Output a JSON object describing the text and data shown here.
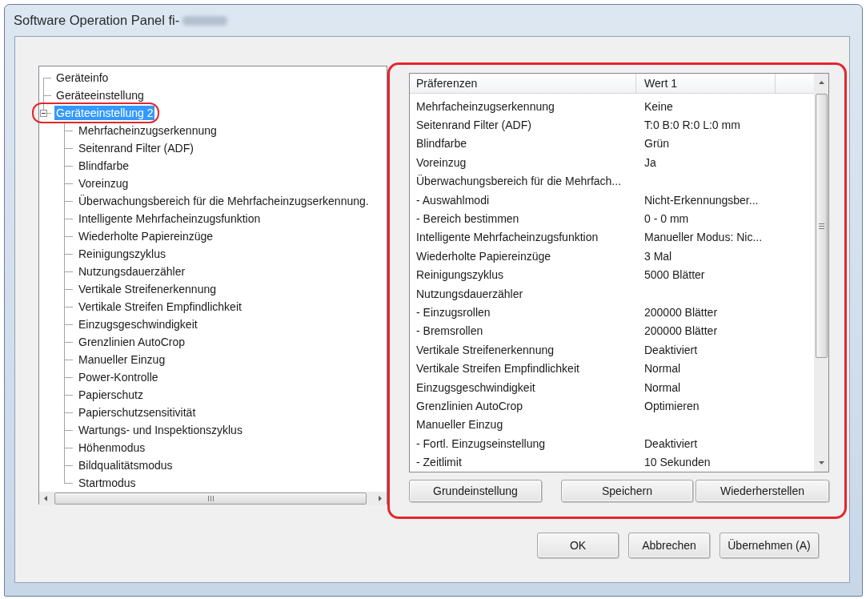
{
  "window": {
    "title": "Software Operation Panel fi-"
  },
  "tree": {
    "items": [
      {
        "label": "Geräteinfo",
        "selected": false,
        "circled": false
      },
      {
        "label": "Geräteeinstellung",
        "selected": false,
        "circled": false
      },
      {
        "label": "Geräteeinstellung 2",
        "selected": true,
        "circled": true,
        "expanded": true,
        "children": [
          {
            "label": "Mehrfacheinzugserkennung",
            "selected": false,
            "circled": false
          },
          {
            "label": "Seitenrand Filter (ADF)",
            "selected": false,
            "circled": false
          },
          {
            "label": "Blindfarbe",
            "selected": false,
            "circled": false
          },
          {
            "label": "Voreinzug",
            "selected": false,
            "circled": false
          },
          {
            "label": "Überwachungsbereich für die Mehrfacheinzugserkennung.",
            "selected": false,
            "circled": false
          },
          {
            "label": "Intelligente Mehrfacheinzugsfunktion",
            "selected": false,
            "circled": false
          },
          {
            "label": "Wiederholte Papiereinzüge",
            "selected": false,
            "circled": false
          },
          {
            "label": "Reinigungszyklus",
            "selected": false,
            "circled": false
          },
          {
            "label": "Nutzungsdauerzähler",
            "selected": false,
            "circled": false
          },
          {
            "label": "Vertikale Streifenerkennung",
            "selected": false,
            "circled": false
          },
          {
            "label": "Vertikale Streifen Empfindlichkeit",
            "selected": false,
            "circled": false
          },
          {
            "label": "Einzugsgeschwindigkeit",
            "selected": false,
            "circled": false
          },
          {
            "label": "Grenzlinien AutoCrop",
            "selected": false,
            "circled": false
          },
          {
            "label": "Manueller Einzug",
            "selected": false,
            "circled": false
          },
          {
            "label": "Power-Kontrolle",
            "selected": false,
            "circled": false
          },
          {
            "label": "Papierschutz",
            "selected": false,
            "circled": false
          },
          {
            "label": "Papierschutzsensitivität",
            "selected": false,
            "circled": false
          },
          {
            "label": "Wartungs- und Inspektionszyklus",
            "selected": false,
            "circled": false
          },
          {
            "label": "Höhenmodus",
            "selected": false,
            "circled": false
          },
          {
            "label": "Bildqualitätsmodus",
            "selected": false,
            "circled": false
          },
          {
            "label": "Startmodus",
            "selected": false,
            "circled": false
          }
        ]
      }
    ]
  },
  "preferences": {
    "circled": true,
    "columns": [
      "Präferenzen",
      "Wert 1"
    ],
    "rows": [
      {
        "preference": "Mehrfacheinzugserkennung",
        "value": "Keine"
      },
      {
        "preference": "Seitenrand Filter (ADF)",
        "value": "T:0 B:0 R:0 L:0 mm"
      },
      {
        "preference": "Blindfarbe",
        "value": "Grün"
      },
      {
        "preference": "Voreinzug",
        "value": "Ja"
      },
      {
        "preference": "Überwachungsbereich für die Mehrfach..."
      },
      {
        "preference": "- Auswahlmodi",
        "value": "Nicht-Erkennungsber..."
      },
      {
        "preference": "- Bereich bestimmen",
        "value": "0 - 0 mm"
      },
      {
        "preference": "Intelligente Mehrfacheinzugsfunktion",
        "value": "Manueller Modus: Nic..."
      },
      {
        "preference": "Wiederholte Papiereinzüge",
        "value": "3 Mal"
      },
      {
        "preference": "Reinigungszyklus",
        "value": "5000 Blätter"
      },
      {
        "preference": "Nutzungsdauerzähler"
      },
      {
        "preference": "- Einzugsrollen",
        "value": "200000 Blätter"
      },
      {
        "preference": "- Bremsrollen",
        "value": "200000 Blätter"
      },
      {
        "preference": "Vertikale Streifenerkennung",
        "value": "Deaktiviert"
      },
      {
        "preference": "Vertikale Streifen Empfindlichkeit",
        "value": "Normal"
      },
      {
        "preference": "Einzugsgeschwindigkeit",
        "value": "Normal"
      },
      {
        "preference": "Grenzlinien AutoCrop",
        "value": "Optimieren"
      },
      {
        "preference": "Manueller Einzug"
      },
      {
        "preference": "- Fortl. Einzugseinstellung",
        "value": "Deaktiviert"
      },
      {
        "preference": "- Zeitlimit",
        "value": "10 Sekunden"
      }
    ],
    "buttons": [
      "Grundeinstellung",
      "Speichern",
      "Wiederherstellen"
    ]
  },
  "buttons": [
    "OK",
    "Abbrechen",
    "Übernehmen (A)"
  ]
}
